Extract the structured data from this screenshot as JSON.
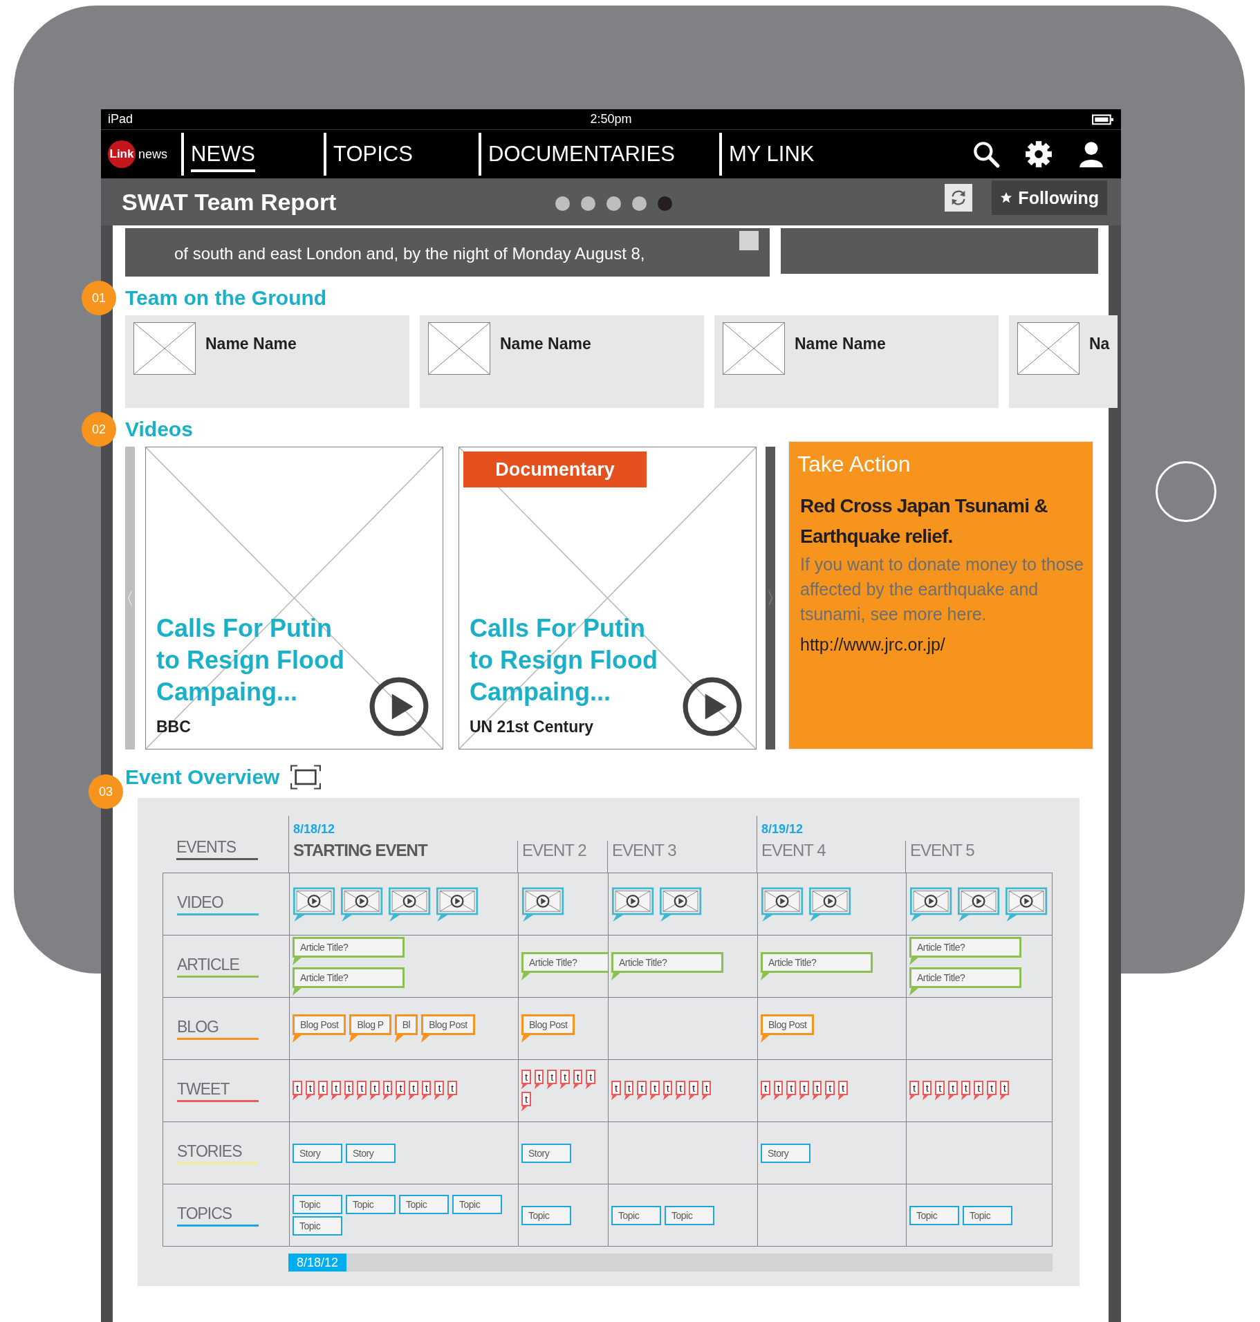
{
  "status_bar": {
    "device": "iPad",
    "time": "2:50pm"
  },
  "nav": {
    "logo": {
      "mark": "Link",
      "word": "news"
    },
    "tabs": [
      {
        "label": "NEWS",
        "selected": true
      },
      {
        "label": "TOPICS",
        "selected": false
      },
      {
        "label": "DOCUMENTARIES",
        "selected": false
      },
      {
        "label": "MY LINK",
        "selected": false
      }
    ]
  },
  "title_bar": {
    "title": "SWAT Team Report",
    "pages": [
      {
        "selected": false
      },
      {
        "selected": false
      },
      {
        "selected": false
      },
      {
        "selected": false
      },
      {
        "selected": true
      }
    ],
    "follow_button": "Following"
  },
  "story_card": {
    "text": "of south and east London and, by the night of Monday August 8,"
  },
  "team": {
    "number": "01",
    "title": "Team on the Ground",
    "members": [
      {
        "name": "Name Name"
      },
      {
        "name": "Name Name"
      },
      {
        "name": "Name Name"
      },
      {
        "name": "Na"
      }
    ]
  },
  "videos": {
    "number": "02",
    "title": "Videos",
    "items": [
      {
        "title": "Calls For Putin to Resign Flood Campaing...",
        "source": "BBC"
      },
      {
        "badge": "Documentary",
        "title": "Calls For Putin to Resign Flood Campaing...",
        "source": "UN 21st Century"
      }
    ],
    "take_action": {
      "heading": "Take Action",
      "title": "Red Cross Japan Tsunami & Earthquake relief.",
      "body": "If you want to donate money to those affected by the earthquake and tsunami, see more here.",
      "link": "http://www.jrc.or.jp/"
    }
  },
  "event_overview": {
    "number": "03",
    "title": "Event Overview",
    "events_label": "EVENTS",
    "events": [
      {
        "date": "8/18/12",
        "label": "STARTING EVENT",
        "major": true
      },
      {
        "label": "EVENT 2",
        "major": false
      },
      {
        "label": "EVENT 3",
        "major": false
      },
      {
        "date": "8/19/12",
        "label": "EVENT 4",
        "major": false
      },
      {
        "label": "EVENT 5",
        "major": false
      }
    ],
    "lanes": [
      {
        "label": "VIDEO",
        "color": "#3fb8d0",
        "cells": [
          [
            {
              "kind": "video"
            },
            {
              "kind": "video"
            },
            {
              "kind": "video"
            },
            {
              "kind": "video"
            }
          ],
          [
            {
              "kind": "video"
            }
          ],
          [
            {
              "kind": "video"
            },
            {
              "kind": "video"
            }
          ],
          [
            {
              "kind": "video"
            },
            {
              "kind": "video"
            }
          ],
          [
            {
              "kind": "video"
            },
            {
              "kind": "video"
            },
            {
              "kind": "video"
            }
          ]
        ]
      },
      {
        "label": "ARTICLE",
        "color": "#8cc152",
        "cells": [
          [
            {
              "kind": "article",
              "text": "Article Title?"
            },
            {
              "kind": "article",
              "text": "Article Title?"
            }
          ],
          [
            {
              "kind": "article",
              "text": "Article Title?"
            }
          ],
          [
            {
              "kind": "article",
              "text": "Article Title?"
            }
          ],
          [
            {
              "kind": "article",
              "text": "Article Title?"
            }
          ],
          [
            {
              "kind": "article",
              "text": "Article Title?"
            },
            {
              "kind": "article",
              "text": "Article Title?"
            }
          ]
        ]
      },
      {
        "label": "BLOG",
        "color": "#f7941d",
        "cells": [
          [
            {
              "kind": "blog",
              "text": "Blog Post"
            },
            {
              "kind": "blog",
              "text": "Blog P"
            },
            {
              "kind": "blog",
              "text": "Bl"
            },
            {
              "kind": "blog",
              "text": "Blog Post"
            }
          ],
          [
            {
              "kind": "blog",
              "text": "Blog Post"
            }
          ],
          [],
          [
            {
              "kind": "blog",
              "text": "Blog Post"
            }
          ],
          []
        ]
      },
      {
        "label": "TWEET",
        "color": "#ec5a5a",
        "cells": [
          [
            {
              "kind": "tweet",
              "text": "t"
            },
            {
              "kind": "tweet",
              "text": "t"
            },
            {
              "kind": "tweet",
              "text": "t"
            },
            {
              "kind": "tweet",
              "text": "t"
            },
            {
              "kind": "tweet",
              "text": "t"
            },
            {
              "kind": "tweet",
              "text": "t"
            },
            {
              "kind": "tweet",
              "text": "t"
            },
            {
              "kind": "tweet",
              "text": "t"
            },
            {
              "kind": "tweet",
              "text": "t"
            },
            {
              "kind": "tweet",
              "text": "t"
            },
            {
              "kind": "tweet",
              "text": "t"
            },
            {
              "kind": "tweet",
              "text": "t"
            },
            {
              "kind": "tweet",
              "text": "t"
            }
          ],
          [
            {
              "kind": "tweet",
              "text": "t"
            },
            {
              "kind": "tweet",
              "text": "t"
            },
            {
              "kind": "tweet",
              "text": "t"
            },
            {
              "kind": "tweet",
              "text": "t"
            },
            {
              "kind": "tweet",
              "text": "t"
            },
            {
              "kind": "tweet",
              "text": "t"
            },
            {
              "kind": "tweet",
              "text": "t"
            }
          ],
          [
            {
              "kind": "tweet",
              "text": "t"
            },
            {
              "kind": "tweet",
              "text": "t"
            },
            {
              "kind": "tweet",
              "text": "t"
            },
            {
              "kind": "tweet",
              "text": "t"
            },
            {
              "kind": "tweet",
              "text": "t"
            },
            {
              "kind": "tweet",
              "text": "t"
            },
            {
              "kind": "tweet",
              "text": "t"
            },
            {
              "kind": "tweet",
              "text": "t"
            }
          ],
          [
            {
              "kind": "tweet",
              "text": "t"
            },
            {
              "kind": "tweet",
              "text": "t"
            },
            {
              "kind": "tweet",
              "text": "t"
            },
            {
              "kind": "tweet",
              "text": "t"
            },
            {
              "kind": "tweet",
              "text": "t"
            },
            {
              "kind": "tweet",
              "text": "t"
            },
            {
              "kind": "tweet",
              "text": "t"
            }
          ],
          [
            {
              "kind": "tweet",
              "text": "t"
            },
            {
              "kind": "tweet",
              "text": "t"
            },
            {
              "kind": "tweet",
              "text": "t"
            },
            {
              "kind": "tweet",
              "text": "t"
            },
            {
              "kind": "tweet",
              "text": "t"
            },
            {
              "kind": "tweet",
              "text": "t"
            },
            {
              "kind": "tweet",
              "text": "t"
            },
            {
              "kind": "tweet",
              "text": "t"
            }
          ]
        ]
      },
      {
        "label": "STORIES",
        "color": "#f5ec8a",
        "cells": [
          [
            {
              "kind": "story",
              "text": "Story"
            },
            {
              "kind": "story",
              "text": "Story"
            }
          ],
          [
            {
              "kind": "story",
              "text": "Story"
            }
          ],
          [],
          [
            {
              "kind": "story",
              "text": "Story"
            }
          ],
          []
        ]
      },
      {
        "label": "TOPICS",
        "color": "#1ca7e0",
        "cells": [
          [
            {
              "kind": "topic",
              "text": "Topic"
            },
            {
              "kind": "topic",
              "text": "Topic"
            },
            {
              "kind": "topic",
              "text": "Topic"
            },
            {
              "kind": "topic",
              "text": "Topic"
            },
            {
              "kind": "topic",
              "text": "Topic"
            }
          ],
          [
            {
              "kind": "topic",
              "text": "Topic"
            }
          ],
          [
            {
              "kind": "topic",
              "text": "Topic"
            },
            {
              "kind": "topic",
              "text": "Topic"
            }
          ],
          [],
          [
            {
              "kind": "topic",
              "text": "Topic"
            },
            {
              "kind": "topic",
              "text": "Topic"
            }
          ]
        ]
      }
    ],
    "scrubber": {
      "label": "8/18/12",
      "level": 0
    }
  }
}
